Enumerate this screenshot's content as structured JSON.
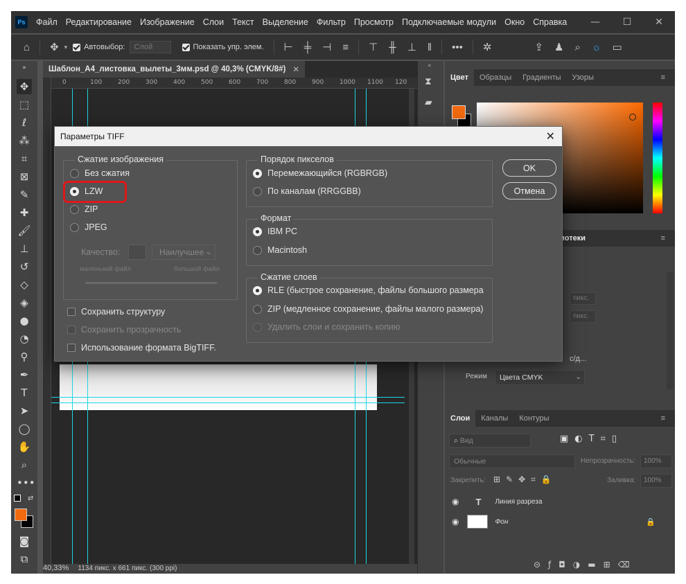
{
  "menubar": {
    "logo": "Ps",
    "items": [
      "Файл",
      "Редактирование",
      "Изображение",
      "Слои",
      "Текст",
      "Выделение",
      "Фильтр",
      "Просмотр",
      "Подключаемые модули",
      "Окно",
      "Справка"
    ],
    "controls": [
      "—",
      "☐",
      "✕"
    ]
  },
  "optionsbar": {
    "autoselect_label": "Автовыбор:",
    "autoselect_value": "Слой",
    "show_controls_label": "Показать упр. элем."
  },
  "document": {
    "tab_title": "Шаблон_А4_листовка_вылеты_3мм.psd @ 40,3% (CMYK/8#)",
    "ruler_ticks": [
      "0",
      "100",
      "200",
      "300",
      "400",
      "500",
      "600",
      "700",
      "800",
      "900",
      "1000",
      "1100",
      "120"
    ],
    "status_zoom": "40,33%",
    "status_info": "1134 пикс. x 661 пикс. (300 ppi)"
  },
  "color_panel": {
    "tabs": [
      "Цвет",
      "Образцы",
      "Градиенты",
      "Узоры"
    ],
    "foreground": "#f26a10",
    "background": "#000000"
  },
  "properties_panel": {
    "tab_fragment": "иотеки",
    "unit1": "пикс.",
    "unit2": "пикс.",
    "resolution_fragment": "с/д...",
    "mode_label": "Режим",
    "mode_value": "Цвета CMYK"
  },
  "layers_panel": {
    "tabs": [
      "Слои",
      "Каналы",
      "Контуры"
    ],
    "filter_placeholder": "Вид",
    "blend_mode": "Обычные",
    "opacity_label": "Непрозрачность:",
    "opacity_value": "100%",
    "lock_label": "Закрепить:",
    "fill_label": "Заливка:",
    "fill_value": "100%",
    "layers": [
      {
        "name": "Линия разреза",
        "type": "text"
      },
      {
        "name": "Фон",
        "type": "image"
      }
    ]
  },
  "dialog": {
    "title": "Параметры TIFF",
    "compression": {
      "title": "Сжатие изображения",
      "options": [
        "Без сжатия",
        "LZW",
        "ZIP",
        "JPEG"
      ],
      "selected": "LZW",
      "quality_label": "Качество:",
      "quality_select": "Наилучшее",
      "small_file": "маленький файл",
      "large_file": "большой файл"
    },
    "checkboxes": [
      "Сохранить структуру",
      "Сохранить прозрачность",
      "Использование формата BigTIFF."
    ],
    "pixel_order": {
      "title": "Порядок пикселов",
      "options": [
        "Перемежающийся (RGBRGB)",
        "По каналам (RRGGBB)"
      ],
      "selected": "Перемежающийся (RGBRGB)"
    },
    "format": {
      "title": "Формат",
      "options": [
        "IBM PC",
        "Macintosh"
      ],
      "selected": "IBM PC"
    },
    "layer_compression": {
      "title": "Сжатие слоев",
      "options": [
        "RLE (быстрое сохранение, файлы большого размера",
        "ZIP (медленное сохранение, файлы малого размера)",
        "Удалить слои и сохранить копию"
      ],
      "selected": "RLE (быстрое сохранение, файлы большого размера"
    },
    "ok": "OK",
    "cancel": "Отмена"
  }
}
